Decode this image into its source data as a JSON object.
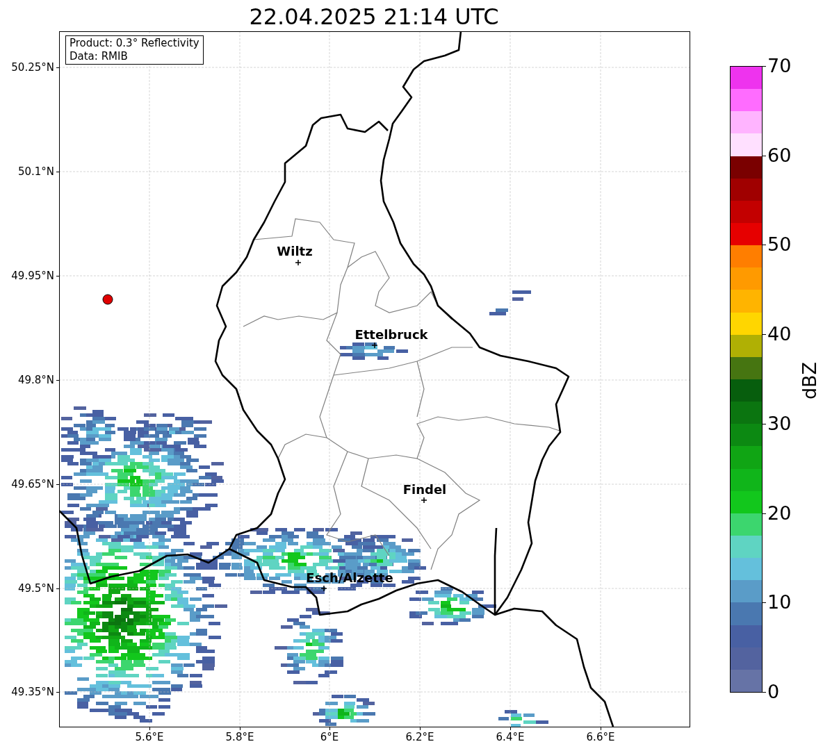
{
  "title": "22.04.2025 21:14 UTC",
  "legend": [
    "Product: 0.3° Reflectivity",
    "Data: RMIB"
  ],
  "lat_ticks": [
    "50.25°N",
    "50.1°N",
    "49.95°N",
    "49.8°N",
    "49.65°N",
    "49.5°N",
    "49.35°N"
  ],
  "lon_ticks": [
    "5.6°E",
    "5.8°E",
    "6°E",
    "6.2°E",
    "6.4°E",
    "6.6°E"
  ],
  "cities": [
    {
      "name": "Wiltz"
    },
    {
      "name": "Ettelbruck"
    },
    {
      "name": "Findel"
    },
    {
      "name": "Esch/Alzette"
    }
  ],
  "colorbar": {
    "label": "dBZ",
    "ticks": [
      "70",
      "60",
      "50",
      "40",
      "30",
      "20",
      "10",
      "0"
    ],
    "bins": [
      {
        "color": "#6673a6"
      },
      {
        "color": "#53639f"
      },
      {
        "color": "#4860a3"
      },
      {
        "color": "#4a78b0"
      },
      {
        "color": "#5a9cc8"
      },
      {
        "color": "#64c0dc"
      },
      {
        "color": "#5fd4c2"
      },
      {
        "color": "#3cd66e"
      },
      {
        "color": "#12c71c"
      },
      {
        "color": "#10b51a"
      },
      {
        "color": "#10a514"
      },
      {
        "color": "#0c8912"
      },
      {
        "color": "#0b7510"
      },
      {
        "color": "#075e0d"
      },
      {
        "color": "#467511"
      },
      {
        "color": "#b0b004"
      },
      {
        "color": "#ffd600"
      },
      {
        "color": "#ffb400"
      },
      {
        "color": "#ff9a00"
      },
      {
        "color": "#ff7e00"
      },
      {
        "color": "#e60000"
      },
      {
        "color": "#c30000"
      },
      {
        "color": "#a00000"
      },
      {
        "color": "#7a0000"
      },
      {
        "color": "#ffe0ff"
      },
      {
        "color": "#ffb4ff"
      },
      {
        "color": "#ff6cff"
      },
      {
        "color": "#ee33ee"
      }
    ]
  }
}
